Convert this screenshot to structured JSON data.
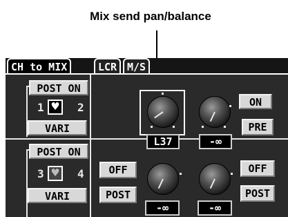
{
  "annotation": {
    "callout": "Mix send pan/balance"
  },
  "tabs": [
    {
      "label": "CH to MIX",
      "active": true
    },
    {
      "label": "LCR",
      "active": false
    },
    {
      "label": "M/S",
      "active": false
    }
  ],
  "channels": {
    "ch1": {
      "post_on": "POST ON",
      "left_num": "1",
      "right_num": "2",
      "vari": "VARI"
    },
    "ch2": {
      "post_on": "POST ON",
      "left_num": "3",
      "right_num": "4",
      "vari": "VARI"
    }
  },
  "row1": {
    "knob1_readout": "L37",
    "knob2_readout": "-∞",
    "on_label": "ON",
    "pre_label": "PRE"
  },
  "row2": {
    "off1_label": "OFF",
    "post1_label": "POST",
    "knob1_readout": "-∞",
    "knob2_readout": "-∞",
    "off2_label": "OFF",
    "post2_label": "POST"
  },
  "colors": {
    "panel_bg": "#2a2a2a",
    "button_bg": "#d8d8d8",
    "frame": "#e8e8e8"
  }
}
